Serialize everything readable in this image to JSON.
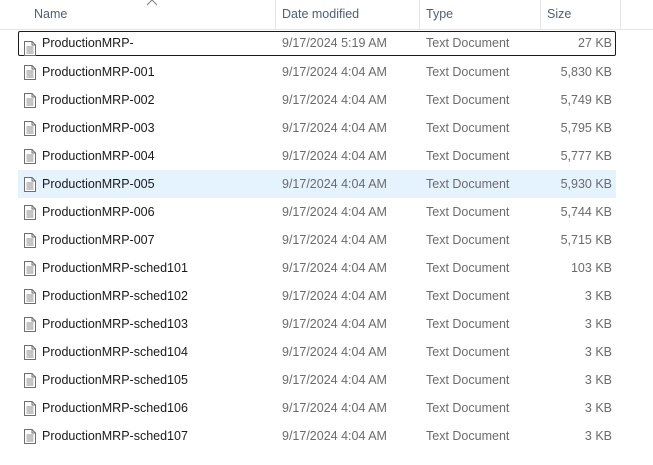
{
  "columns": {
    "name": "Name",
    "date": "Date modified",
    "type": "Type",
    "size": "Size"
  },
  "sort": {
    "column": "name",
    "direction": "ascending",
    "icon": "chevron-up-icon"
  },
  "files": [
    {
      "name": "ProductionMRP-",
      "date": "9/17/2024 5:19 AM",
      "type": "Text Document",
      "size": "27 KB",
      "state": "focused",
      "icon": "text-document-icon"
    },
    {
      "name": "ProductionMRP-001",
      "date": "9/17/2024 4:04 AM",
      "type": "Text Document",
      "size": "5,830 KB",
      "state": "",
      "icon": "text-document-icon"
    },
    {
      "name": "ProductionMRP-002",
      "date": "9/17/2024 4:04 AM",
      "type": "Text Document",
      "size": "5,749 KB",
      "state": "",
      "icon": "text-document-icon"
    },
    {
      "name": "ProductionMRP-003",
      "date": "9/17/2024 4:04 AM",
      "type": "Text Document",
      "size": "5,795 KB",
      "state": "",
      "icon": "text-document-icon"
    },
    {
      "name": "ProductionMRP-004",
      "date": "9/17/2024 4:04 AM",
      "type": "Text Document",
      "size": "5,777 KB",
      "state": "",
      "icon": "text-document-icon"
    },
    {
      "name": "ProductionMRP-005",
      "date": "9/17/2024 4:04 AM",
      "type": "Text Document",
      "size": "5,930 KB",
      "state": "hover",
      "icon": "text-document-icon"
    },
    {
      "name": "ProductionMRP-006",
      "date": "9/17/2024 4:04 AM",
      "type": "Text Document",
      "size": "5,744 KB",
      "state": "",
      "icon": "text-document-icon"
    },
    {
      "name": "ProductionMRP-007",
      "date": "9/17/2024 4:04 AM",
      "type": "Text Document",
      "size": "5,715 KB",
      "state": "",
      "icon": "text-document-icon"
    },
    {
      "name": "ProductionMRP-sched101",
      "date": "9/17/2024 4:04 AM",
      "type": "Text Document",
      "size": "103 KB",
      "state": "",
      "icon": "text-document-icon"
    },
    {
      "name": "ProductionMRP-sched102",
      "date": "9/17/2024 4:04 AM",
      "type": "Text Document",
      "size": "3 KB",
      "state": "",
      "icon": "text-document-icon"
    },
    {
      "name": "ProductionMRP-sched103",
      "date": "9/17/2024 4:04 AM",
      "type": "Text Document",
      "size": "3 KB",
      "state": "",
      "icon": "text-document-icon"
    },
    {
      "name": "ProductionMRP-sched104",
      "date": "9/17/2024 4:04 AM",
      "type": "Text Document",
      "size": "3 KB",
      "state": "",
      "icon": "text-document-icon"
    },
    {
      "name": "ProductionMRP-sched105",
      "date": "9/17/2024 4:04 AM",
      "type": "Text Document",
      "size": "3 KB",
      "state": "",
      "icon": "text-document-icon"
    },
    {
      "name": "ProductionMRP-sched106",
      "date": "9/17/2024 4:04 AM",
      "type": "Text Document",
      "size": "3 KB",
      "state": "",
      "icon": "text-document-icon"
    },
    {
      "name": "ProductionMRP-sched107",
      "date": "9/17/2024 4:04 AM",
      "type": "Text Document",
      "size": "3 KB",
      "state": "",
      "icon": "text-document-icon"
    }
  ],
  "colors": {
    "header_text": "#4c607a",
    "hover_bg": "#e5f3ff",
    "secondary_text": "#6b6b6b"
  }
}
